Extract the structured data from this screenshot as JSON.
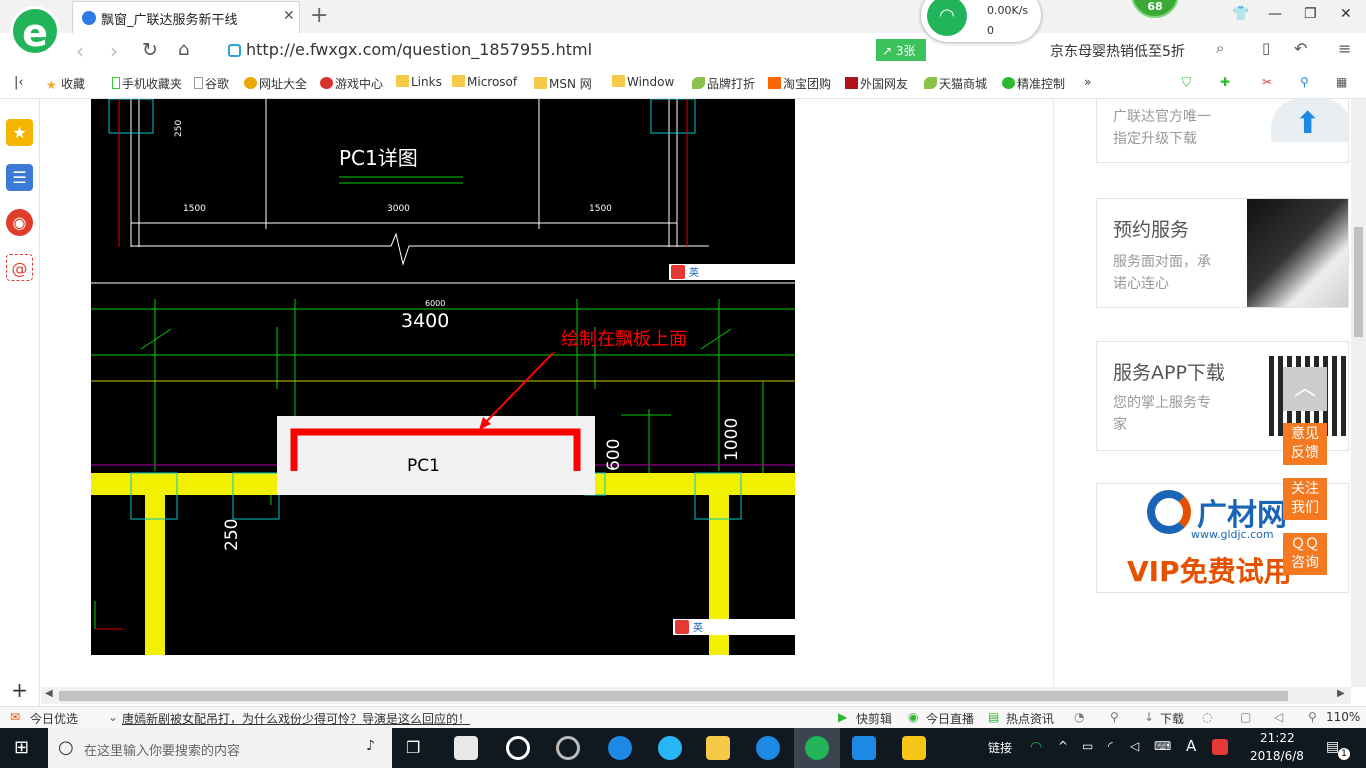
{
  "browser": {
    "tab_title": "飘窗_广联达服务新干线",
    "url": "http://e.fwxgx.com/question_1857955.html",
    "badge_count": "68",
    "green_button": "3张",
    "network_speed": "0.00K/s",
    "network_count": "0",
    "promo_text": "京东母婴热销低至5折"
  },
  "bookmarks": [
    "收藏",
    "手机收藏夹",
    "谷歌",
    "网址大全",
    "游戏中心",
    "Links",
    "Microsof",
    "MSN 网",
    "Window",
    "品牌打折",
    "淘宝团购",
    "外国网友",
    "天猫商城",
    "精准控制"
  ],
  "cad": {
    "top_title": "PC1详图",
    "top_dim_left": "1500",
    "top_dim_mid": "3000",
    "top_dim_right": "1500",
    "top_dim_vertical": "250",
    "dim_small": "6000",
    "dim_main": "3400",
    "annotation": "绘制在飘板上面",
    "component_label": "PC1",
    "dim_600": "600",
    "dim_1000": "1000",
    "dim_250": "250",
    "ime_label": "英"
  },
  "side_cards": {
    "upgrade": {
      "line1": "广联达官方唯一",
      "line2": "指定升级下载"
    },
    "service": {
      "title": "预约服务",
      "line1": "服务面对面，承",
      "line2": "诺心连心"
    },
    "app": {
      "title": "服务APP下载",
      "line1": "您的掌上服务专",
      "line2": "家"
    },
    "ad": {
      "brand": "广材网",
      "site": "www.gldjc.com",
      "vip": "VIP免费试用"
    }
  },
  "floating_buttons": [
    {
      "l1": "意见",
      "l2": "反馈"
    },
    {
      "l1": "关注",
      "l2": "我们"
    },
    {
      "l1": "ＱＱ",
      "l2": "咨询"
    }
  ],
  "statusbar": {
    "left": "今日优选",
    "news": "唐嫣新剧被女配吊打，为什么戏份少得可怜？导演是这么回应的！",
    "items": [
      "快剪辑",
      "今日直播",
      "热点资讯",
      "下载"
    ],
    "zoom": "110%"
  },
  "taskbar": {
    "search_placeholder": "在这里输入你要搜索的内容",
    "link_label": "链接",
    "ime": "A",
    "time": "21:22",
    "date": "2018/6/8",
    "notif": "1"
  },
  "colors": {
    "brand_green": "#21b459",
    "accent_orange": "#f47920",
    "cad_yellow": "#f0f000",
    "cad_red": "#ff0000",
    "cad_green": "#00c800"
  }
}
